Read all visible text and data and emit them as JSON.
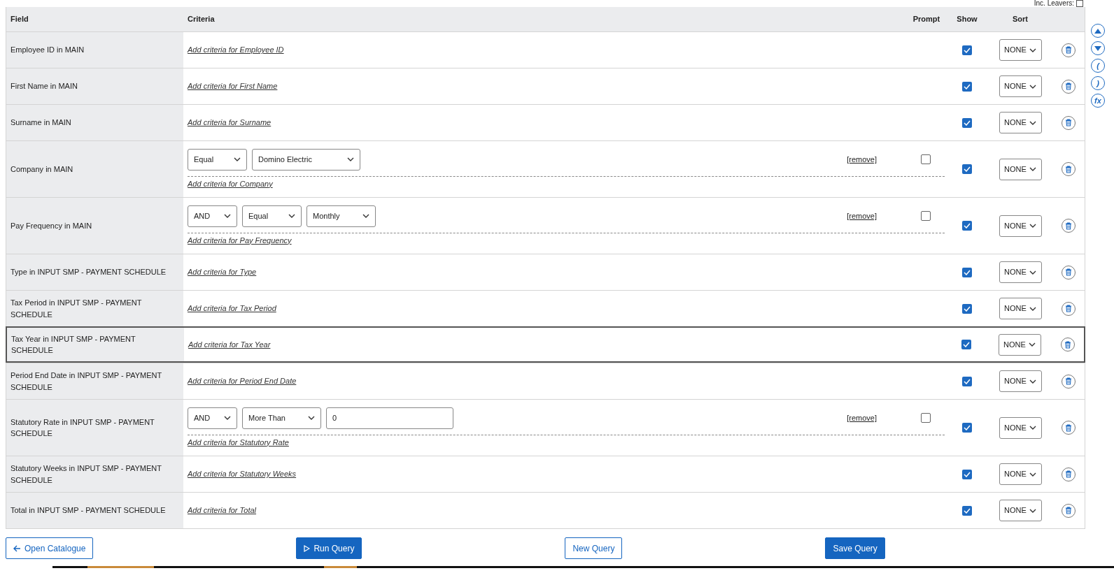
{
  "leavers": {
    "label": "Inc. Leavers:",
    "checked": false
  },
  "columns": [
    "Field",
    "Criteria",
    "Prompt",
    "Show",
    "Sort"
  ],
  "rows": [
    {
      "field": "Employee ID in MAIN",
      "criteria": [],
      "add_label": "Add criteria for Employee ID",
      "show": true,
      "sort": "NONE",
      "selected": false
    },
    {
      "field": "First Name in MAIN",
      "criteria": [],
      "add_label": "Add criteria for First Name",
      "show": true,
      "sort": "NONE",
      "selected": false
    },
    {
      "field": "Surname in MAIN",
      "criteria": [],
      "add_label": "Add criteria for Surname",
      "show": true,
      "sort": "NONE",
      "selected": false
    },
    {
      "field": "Company in MAIN",
      "criteria": [
        {
          "controls": [
            {
              "kind": "select",
              "value": "Equal"
            },
            {
              "kind": "select",
              "value": "Domino Electric"
            }
          ],
          "remove": "[remove]",
          "prompt": false
        }
      ],
      "add_label": "Add criteria for Company",
      "show": true,
      "sort": "NONE",
      "selected": false
    },
    {
      "field": "Pay Frequency in MAIN",
      "criteria": [
        {
          "controls": [
            {
              "kind": "select",
              "value": "AND"
            },
            {
              "kind": "select",
              "value": "Equal"
            },
            {
              "kind": "select",
              "value": "Monthly"
            }
          ],
          "remove": "[remove]",
          "prompt": false
        }
      ],
      "add_label": "Add criteria for Pay Frequency",
      "show": true,
      "sort": "NONE",
      "selected": false
    },
    {
      "field": "Type in INPUT SMP - PAYMENT SCHEDULE",
      "criteria": [],
      "add_label": "Add criteria for Type",
      "show": true,
      "sort": "NONE",
      "selected": false
    },
    {
      "field": "Tax Period in INPUT SMP - PAYMENT SCHEDULE",
      "criteria": [],
      "add_label": "Add criteria for Tax Period",
      "show": true,
      "sort": "NONE",
      "selected": false
    },
    {
      "field": "Tax Year in INPUT SMP - PAYMENT SCHEDULE",
      "criteria": [],
      "add_label": "Add criteria for Tax Year",
      "show": true,
      "sort": "NONE",
      "selected": true
    },
    {
      "field": "Period End Date in INPUT SMP - PAYMENT SCHEDULE",
      "criteria": [],
      "add_label": "Add criteria for Period End Date",
      "show": true,
      "sort": "NONE",
      "selected": false
    },
    {
      "field": "Statutory Rate in INPUT SMP - PAYMENT SCHEDULE",
      "criteria": [
        {
          "controls": [
            {
              "kind": "select",
              "value": "AND"
            },
            {
              "kind": "select",
              "value": "More Than"
            },
            {
              "kind": "input",
              "value": "0"
            }
          ],
          "remove": "[remove]",
          "prompt": false
        }
      ],
      "add_label": "Add criteria for Statutory Rate",
      "show": true,
      "sort": "NONE",
      "selected": false
    },
    {
      "field": "Statutory Weeks in INPUT SMP - PAYMENT SCHEDULE",
      "criteria": [],
      "add_label": "Add criteria for Statutory Weeks",
      "show": true,
      "sort": "NONE",
      "selected": false
    },
    {
      "field": "Total in INPUT SMP - PAYMENT SCHEDULE",
      "criteria": [],
      "add_label": "Add criteria for Total",
      "show": true,
      "sort": "NONE",
      "selected": false
    }
  ],
  "side_buttons": [
    {
      "kind": "up"
    },
    {
      "kind": "down"
    },
    {
      "kind": "text",
      "label": "("
    },
    {
      "kind": "text",
      "label": ")"
    },
    {
      "kind": "text",
      "label": "fx"
    }
  ],
  "buttons": [
    {
      "label": "Open Catalogue",
      "kind": "back",
      "primary": false
    },
    {
      "label": "Run Query",
      "kind": "run",
      "primary": true
    },
    {
      "label": "New Query",
      "kind": "plain",
      "primary": false
    },
    {
      "label": "Save Query",
      "kind": "plain",
      "primary": true
    }
  ]
}
